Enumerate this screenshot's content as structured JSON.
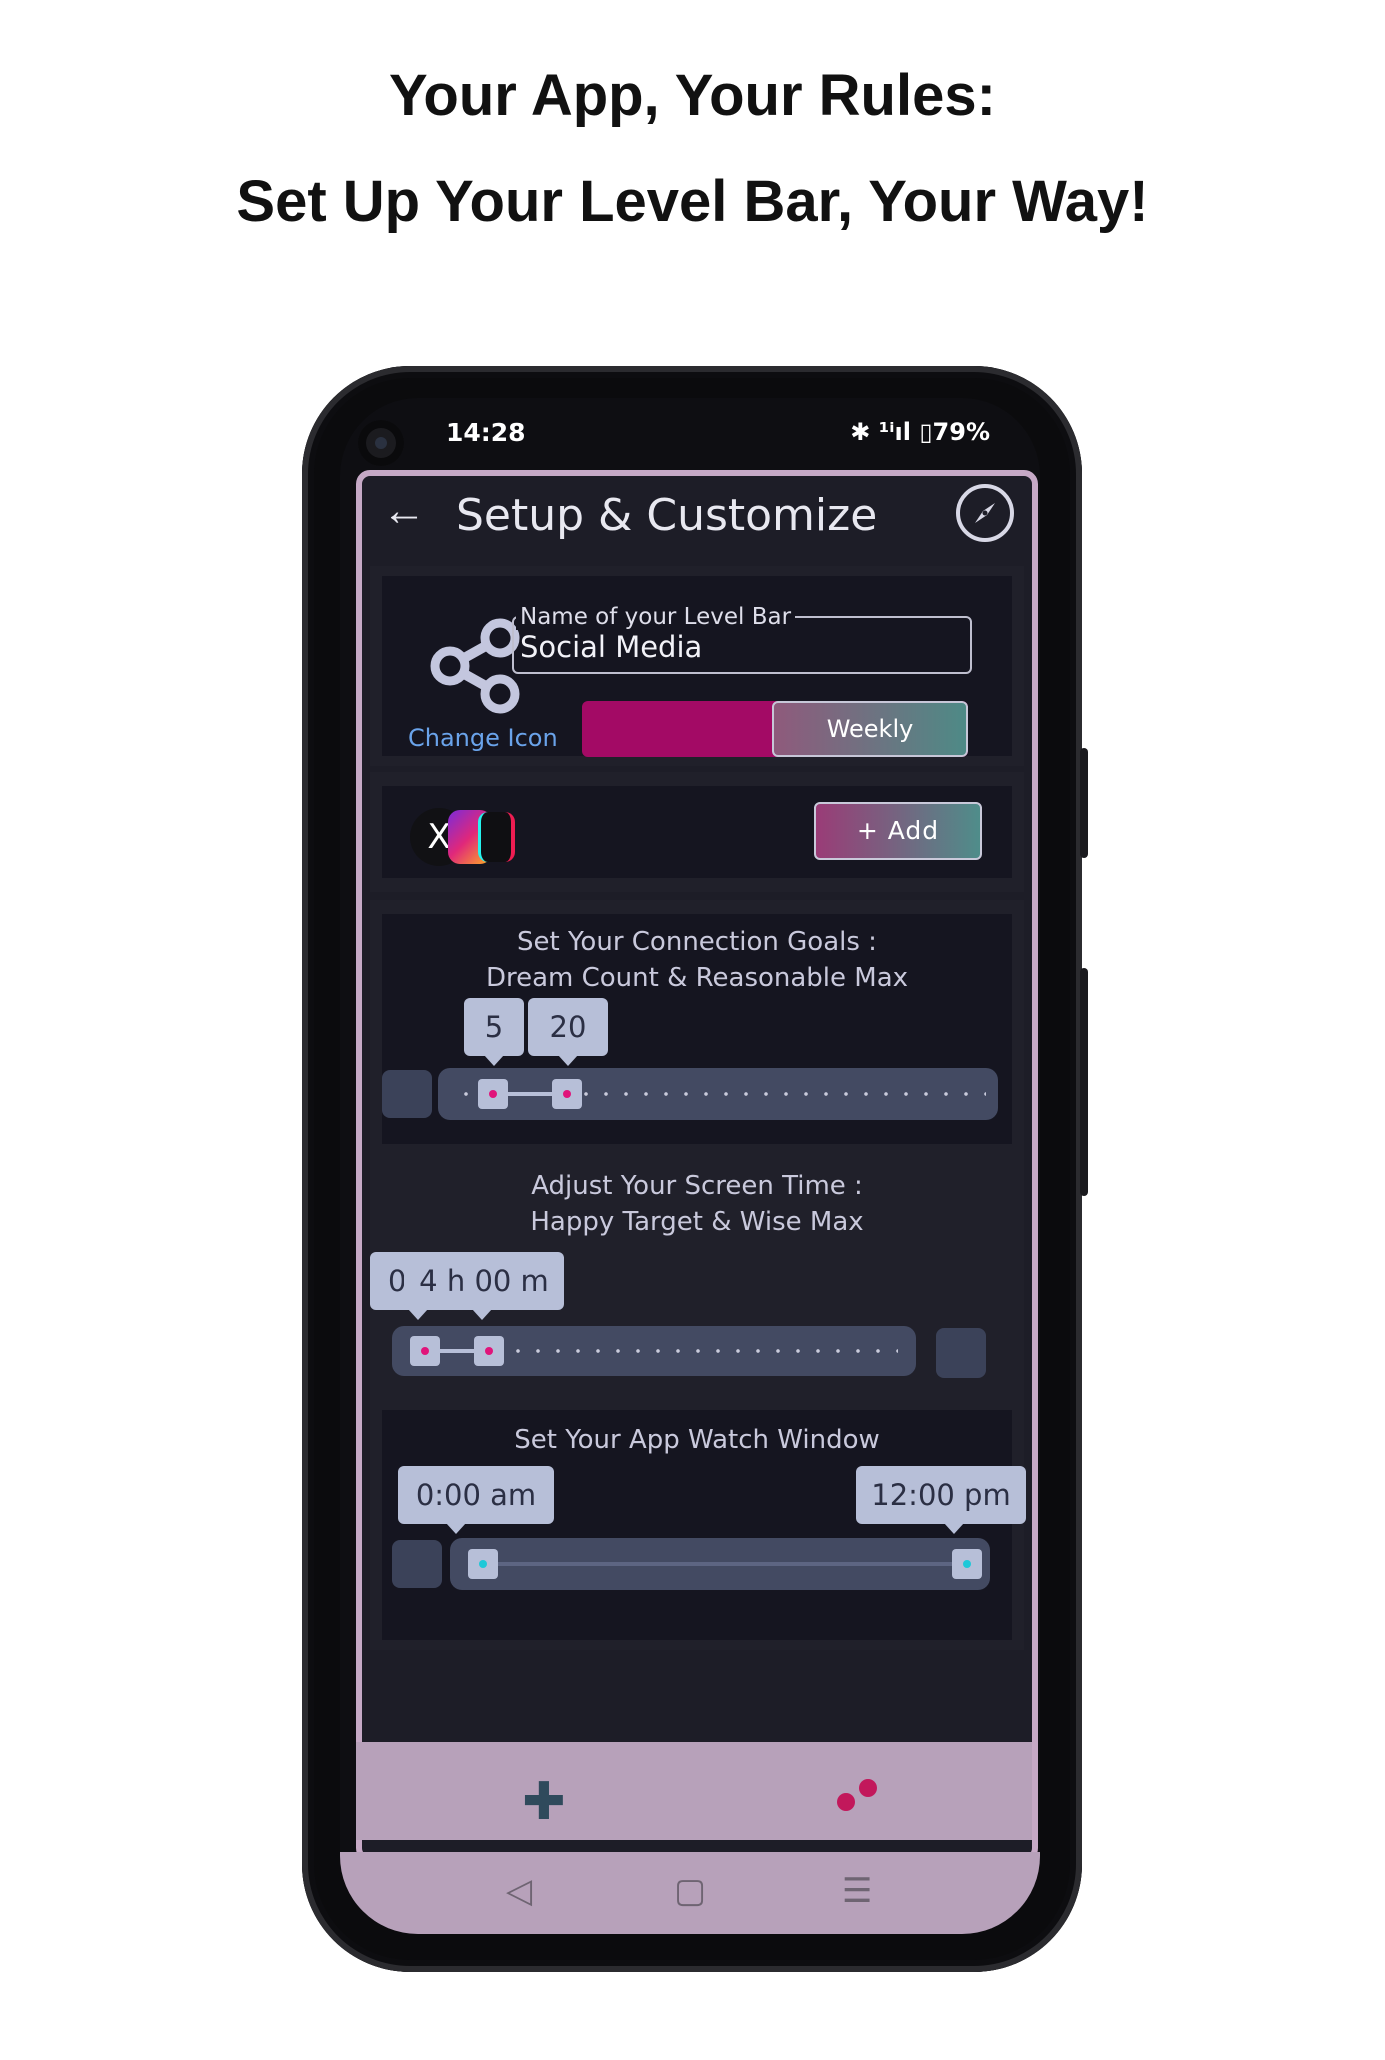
{
  "promo": {
    "headline_line1": "Your App, Your Rules:",
    "headline_line2": "Set Up Your Level Bar, Your Way!"
  },
  "status_bar": {
    "time": "14:28",
    "indicators": "✱ ¹ⁱıl ▯79%"
  },
  "header": {
    "back_icon": "arrow-left-icon",
    "title": "Setup & Customize",
    "compass_icon": "compass-icon"
  },
  "level_bar": {
    "icon": "share-icon",
    "change_icon_label": "Change Icon",
    "name_label": "Name of your Level Bar",
    "name_value": "Social Media",
    "period_selected": "Weekly"
  },
  "apps": {
    "icons": [
      "x-icon",
      "instagram-icon",
      "tiktok-icon"
    ],
    "x_glyph": "X",
    "add_label": "+ Add"
  },
  "connection_goals": {
    "title_line1": "Set Your Connection Goals :",
    "title_line2": "Dream Count & Reasonable Max",
    "dream_count": "5",
    "reasonable_max": "20"
  },
  "screen_time": {
    "title_line1": "Adjust Your Screen Time :",
    "title_line2": "Happy Target & Wise Max",
    "happy_target_partial": "0",
    "wise_max": "4 h 00 m"
  },
  "watch_window": {
    "title": "Set Your App Watch Window",
    "start": "0:00 am",
    "end": "12:00 pm"
  },
  "bottom_nav": {
    "plus_icon": "plus-icon",
    "dots_icon": "dots-icon",
    "accent": "#c2185b"
  },
  "system_nav": {
    "back": "◁",
    "home": "▢",
    "menu": "☰"
  },
  "colors": {
    "frame": "#c6a9c6",
    "accent_magenta": "#a30a65",
    "teal": "#4e8a86",
    "thumb": "#b7bfd8"
  }
}
